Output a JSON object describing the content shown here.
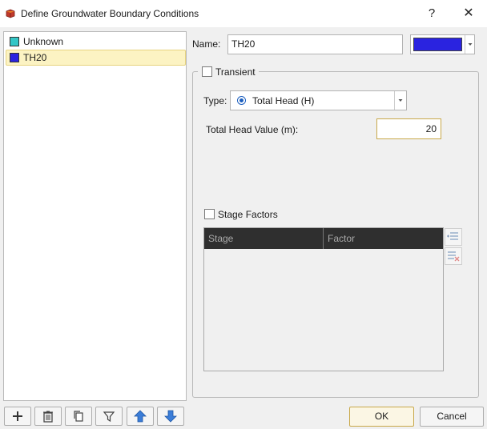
{
  "window": {
    "title": "Define Groundwater Boundary Conditions",
    "help_glyph": "?",
    "close_glyph": "✕"
  },
  "conditions_list": [
    {
      "label": "Unknown",
      "color": "#33c6c6",
      "selected": false
    },
    {
      "label": "TH20",
      "color": "#2a23e0",
      "selected": true
    }
  ],
  "toolbar": {
    "buttons": [
      "add-icon",
      "delete-icon",
      "copy-icon",
      "filter-icon",
      "move-up-icon",
      "move-down-icon"
    ]
  },
  "properties": {
    "name_label": "Name:",
    "name_value": "TH20",
    "color": "#2a23e0",
    "transient_label": "Transient",
    "transient_checked": false,
    "type_label": "Type:",
    "type_value": "Total Head (H)",
    "head_label": "Total Head Value (m):",
    "head_value": "20",
    "stage_factors_label": "Stage Factors",
    "stage_factors_checked": false,
    "table_columns": [
      "Stage",
      "Factor"
    ]
  },
  "dialog_buttons": {
    "ok": "OK",
    "cancel": "Cancel"
  }
}
